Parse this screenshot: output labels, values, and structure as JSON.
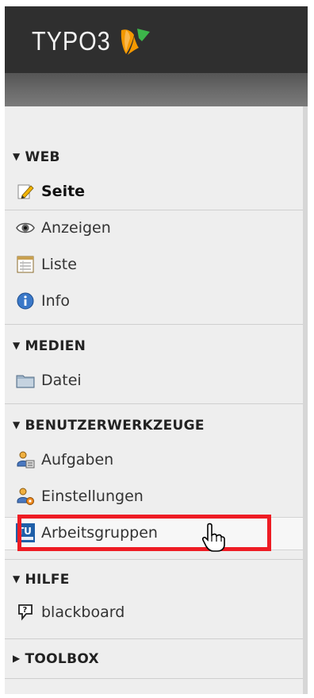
{
  "header": {
    "logo_text": "TYPO3"
  },
  "sections": {
    "web": {
      "title": "WEB",
      "items": [
        {
          "label": "Seite",
          "icon": "page-edit-icon",
          "active": true
        },
        {
          "label": "Anzeigen",
          "icon": "eye-icon"
        },
        {
          "label": "Liste",
          "icon": "list-icon"
        },
        {
          "label": "Info",
          "icon": "info-icon"
        }
      ]
    },
    "medien": {
      "title": "MEDIEN",
      "items": [
        {
          "label": "Datei",
          "icon": "folder-icon"
        }
      ]
    },
    "benutzer": {
      "title": "BENUTZERWERKZEUGE",
      "items": [
        {
          "label": "Aufgaben",
          "icon": "user-tasks-icon"
        },
        {
          "label": "Einstellungen",
          "icon": "user-settings-icon"
        },
        {
          "label": "Arbeitsgruppen",
          "icon": "tu-wien-icon",
          "highlighted": true
        }
      ]
    },
    "hilfe": {
      "title": "HILFE",
      "items": [
        {
          "label": "blackboard",
          "icon": "help-icon"
        }
      ]
    },
    "toolbox": {
      "title": "TOOLBOX",
      "collapsed": true
    }
  },
  "colors": {
    "highlight_border": "#ee1c24",
    "logo_orange": "#f49800",
    "logo_green": "#3cb54a"
  }
}
